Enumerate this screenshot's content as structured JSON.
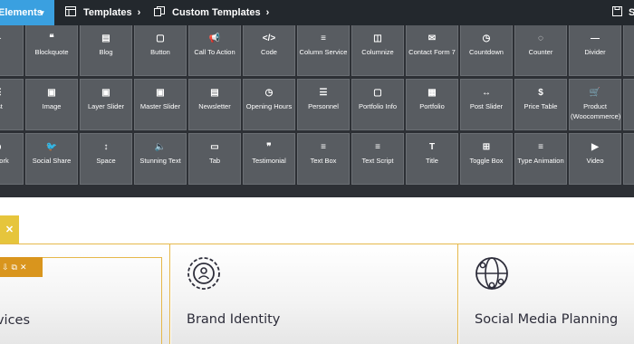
{
  "topbar": {
    "elements_label": "Elements",
    "templates_label": "Templates",
    "custom_templates_label": "Custom Templates",
    "save_label": "Sa"
  },
  "elements": [
    {
      "label": "io",
      "icon": "▶"
    },
    {
      "label": "Blockquote",
      "icon": "❝"
    },
    {
      "label": "Blog",
      "icon": "▤"
    },
    {
      "label": "Button",
      "icon": "▢"
    },
    {
      "label": "Call To Action",
      "icon": "📢"
    },
    {
      "label": "Code",
      "icon": "</>"
    },
    {
      "label": "Column Service",
      "icon": "≡"
    },
    {
      "label": "Columnize",
      "icon": "◫"
    },
    {
      "label": "Contact Form 7",
      "icon": "✉"
    },
    {
      "label": "Countdown",
      "icon": "◷"
    },
    {
      "label": "Counter",
      "icon": "◌"
    },
    {
      "label": "Divider",
      "icon": "—"
    },
    {
      "label": "Fea",
      "icon": "▭"
    },
    {
      "label": "List",
      "icon": "☰"
    },
    {
      "label": "Image",
      "icon": "▣"
    },
    {
      "label": "Layer Slider",
      "icon": "▣"
    },
    {
      "label": "Master Slider",
      "icon": "▣"
    },
    {
      "label": "Newsletter",
      "icon": "▤"
    },
    {
      "label": "Opening Hours",
      "icon": "◷"
    },
    {
      "label": "Personnel",
      "icon": "☰"
    },
    {
      "label": "Portfolio Info",
      "icon": "▢"
    },
    {
      "label": "Portfolio",
      "icon": "▦"
    },
    {
      "label": "Post Slider",
      "icon": "↔"
    },
    {
      "label": "Price Table",
      "icon": "$"
    },
    {
      "label": "Product (Woocommerce)",
      "icon": "🛒"
    },
    {
      "label": "Prog",
      "icon": "▭"
    },
    {
      "label": "ial work",
      "icon": "◎"
    },
    {
      "label": "Social Share",
      "icon": "🐦"
    },
    {
      "label": "Space",
      "icon": "↕"
    },
    {
      "label": "Stunning Text",
      "icon": "🔈"
    },
    {
      "label": "Tab",
      "icon": "▭"
    },
    {
      "label": "Testimonial",
      "icon": "❞"
    },
    {
      "label": "Text Box",
      "icon": "≡"
    },
    {
      "label": "Text Script",
      "icon": "≡"
    },
    {
      "label": "Title",
      "icon": "T"
    },
    {
      "label": "Toggle Box",
      "icon": "⊞"
    },
    {
      "label": "Type Animation",
      "icon": "≡"
    },
    {
      "label": "Video",
      "icon": "▶"
    },
    {
      "label": "",
      "icon": "▭"
    }
  ],
  "page": {
    "close_tab_glyph": "✕",
    "toolbar_glyphs": [
      "⇩",
      "⧉",
      "✕"
    ],
    "columns": [
      {
        "title": "rvices"
      },
      {
        "title": "Brand Identity"
      },
      {
        "title": "Social Media Planning"
      }
    ]
  },
  "colors": {
    "topbar_bg": "#23282d",
    "elements_tab_bg": "#3aa0e0",
    "panel_bg": "#2d3035",
    "tile_bg": "#585c61",
    "accent_gold": "#e6b84a",
    "toolbar_orange": "#d9951d",
    "close_tab_yellow": "#e6c53c"
  }
}
